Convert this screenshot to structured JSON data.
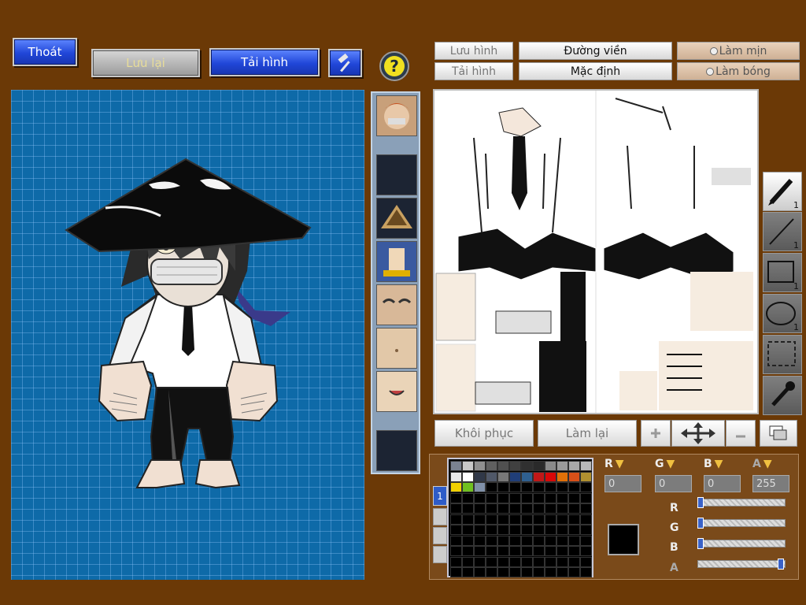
{
  "toolbar": {
    "exit_label": "Thoát",
    "save_label": "Lưu lại",
    "load_image_label": "Tải hình"
  },
  "texture_panel": {
    "tabs": {
      "save_image": "Lưu hình",
      "outline": "Đường viền",
      "smooth": "Làm mịn",
      "load_image": "Tải hình",
      "default": "Mặc định",
      "shade": "Làm bóng"
    },
    "restore_label": "Khôi phục",
    "redo_label": "Làm lại"
  },
  "tools": [
    {
      "name": "pen",
      "count": "1"
    },
    {
      "name": "line",
      "count": "1"
    },
    {
      "name": "rectangle",
      "count": "1"
    },
    {
      "name": "ellipse",
      "count": "1"
    },
    {
      "name": "select",
      "count": ""
    },
    {
      "name": "eyedropper",
      "count": ""
    }
  ],
  "color": {
    "r_value": "0",
    "g_value": "0",
    "b_value": "0",
    "a_value": "255",
    "current": "#000000",
    "r_label": "R",
    "g_label": "G",
    "b_label": "B",
    "a_label": "A"
  },
  "palette": [
    "#7a8290",
    "#c8c8c8",
    "#909090",
    "#606060",
    "#505050",
    "#404040",
    "#303030",
    "#2a2a2a",
    "#8a8a8a",
    "#9a9a9a",
    "#a8a8a8",
    "#b8b8b8",
    "#e8e8e8",
    "#ffffff",
    "#303848",
    "#505868",
    "#787878",
    "#203e78",
    "#2f6090",
    "#c01818",
    "#d80808",
    "#e07008",
    "#d85018",
    "#b09030",
    "#f0d000",
    "#70c020",
    "#8090a8"
  ],
  "icons": [
    "hammer-icon",
    "help-icon",
    "pen-icon",
    "line-icon",
    "rectangle-icon",
    "ellipse-icon",
    "select-icon",
    "eyedropper-icon",
    "zoom-in-icon",
    "move-icon",
    "zoom-out-icon",
    "layers-icon"
  ]
}
